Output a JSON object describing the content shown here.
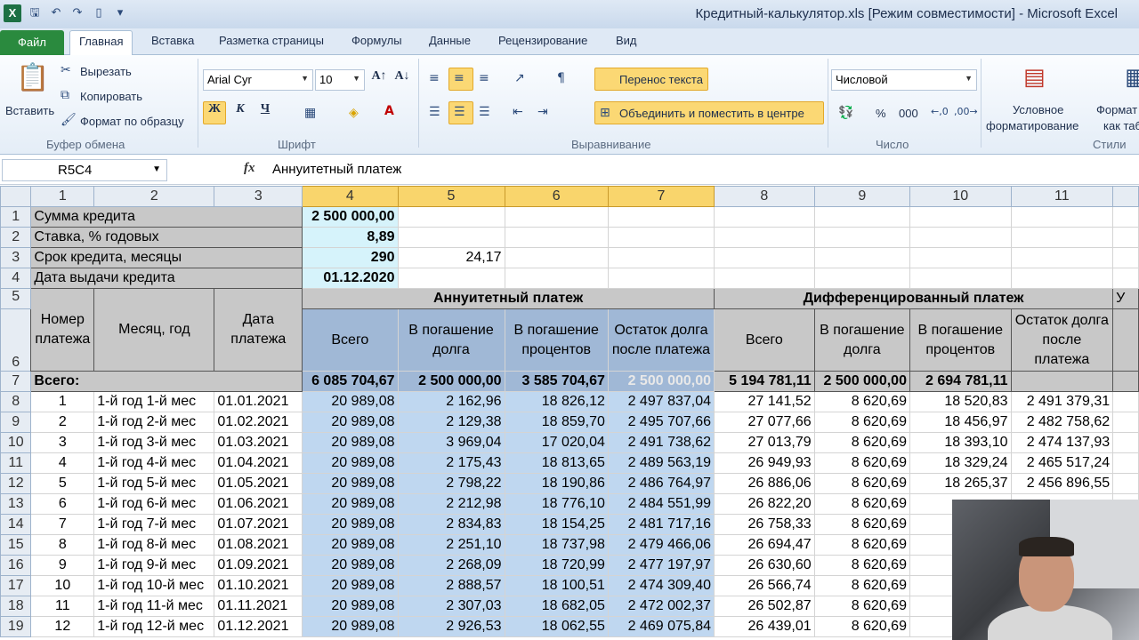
{
  "window": {
    "app_icon": "X",
    "title": "Кредитный-калькулятор.xls  [Режим совместимости] - Microsoft Excel"
  },
  "ribbon_tabs": [
    "Файл",
    "Главная",
    "Вставка",
    "Разметка страницы",
    "Формулы",
    "Данные",
    "Рецензирование",
    "Вид"
  ],
  "ribbon": {
    "paste": "Вставить",
    "cut": "Вырезать",
    "copy": "Копировать",
    "format_painter": "Формат по образцу",
    "clipboard_group": "Буфер обмена",
    "font_name": "Arial Cyr",
    "font_size": "10",
    "bold": "Ж",
    "italic": "К",
    "underline": "Ч",
    "font_group": "Шрифт",
    "wrap_text": "Перенос текста",
    "merge_center": "Объединить и поместить в центре",
    "alignment_group": "Выравнивание",
    "number_format": "Числовой",
    "percent": "%",
    "thousands": "000",
    "number_group": "Число",
    "cond_format_1": "Условное",
    "cond_format_2": "форматирование",
    "styles_1": "Формат",
    "styles_2": "как таб",
    "styles_group": "Стили"
  },
  "formula_bar": {
    "name_box": "R5C4",
    "fx": "fx",
    "value": "Аннуитетный платеж"
  },
  "columns": [
    "1",
    "2",
    "3",
    "4",
    "5",
    "6",
    "7",
    "8",
    "9",
    "10",
    "11"
  ],
  "params": [
    {
      "row": "1",
      "label": "Сумма кредита",
      "value": "2 500 000,00",
      "extra": ""
    },
    {
      "row": "2",
      "label": "Ставка, % годовых",
      "value": "8,89",
      "extra": ""
    },
    {
      "row": "3",
      "label": "Срок кредита, месяцы",
      "value": "290",
      "extra": "24,17"
    },
    {
      "row": "4",
      "label": "Дата выдачи кредита",
      "value": "01.12.2020",
      "extra": ""
    }
  ],
  "headers": {
    "row5": "5",
    "row6": "6",
    "num": "Номер платежа",
    "month": "Месяц, год",
    "date": "Дата платежа",
    "annuity": "Аннуитетный платеж",
    "diff": "Дифференцированный платеж",
    "total": "Всего",
    "principal_ann": "В погашение долга",
    "interest": "В погашение процентов",
    "balance": "Остаток долга после платежа",
    "principal_diff": "В погашение долга",
    "cut_off": "У"
  },
  "totals": {
    "row": "7",
    "label": "Всего:",
    "ann_total": "6 085 704,67",
    "ann_principal": "2 500 000,00",
    "ann_interest": "3 585 704,67",
    "ann_balance": "2 500 000,00",
    "diff_total": "5 194 781,11",
    "diff_principal": "2 500 000,00",
    "diff_interest": "2 694 781,11"
  },
  "rows": [
    {
      "r": "8",
      "n": "1",
      "m": "1-й год 1-й мес",
      "d": "01.01.2021",
      "a1": "20 989,08",
      "a2": "2 162,96",
      "a3": "18 826,12",
      "a4": "2 497 837,04",
      "d1": "27 141,52",
      "d2": "8 620,69",
      "d3": "18 520,83",
      "d4": "2 491 379,31"
    },
    {
      "r": "9",
      "n": "2",
      "m": "1-й год 2-й мес",
      "d": "01.02.2021",
      "a1": "20 989,08",
      "a2": "2 129,38",
      "a3": "18 859,70",
      "a4": "2 495 707,66",
      "d1": "27 077,66",
      "d2": "8 620,69",
      "d3": "18 456,97",
      "d4": "2 482 758,62"
    },
    {
      "r": "10",
      "n": "3",
      "m": "1-й год 3-й мес",
      "d": "01.03.2021",
      "a1": "20 989,08",
      "a2": "3 969,04",
      "a3": "17 020,04",
      "a4": "2 491 738,62",
      "d1": "27 013,79",
      "d2": "8 620,69",
      "d3": "18 393,10",
      "d4": "2 474 137,93"
    },
    {
      "r": "11",
      "n": "4",
      "m": "1-й год 4-й мес",
      "d": "01.04.2021",
      "a1": "20 989,08",
      "a2": "2 175,43",
      "a3": "18 813,65",
      "a4": "2 489 563,19",
      "d1": "26 949,93",
      "d2": "8 620,69",
      "d3": "18 329,24",
      "d4": "2 465 517,24"
    },
    {
      "r": "12",
      "n": "5",
      "m": "1-й год 5-й мес",
      "d": "01.05.2021",
      "a1": "20 989,08",
      "a2": "2 798,22",
      "a3": "18 190,86",
      "a4": "2 486 764,97",
      "d1": "26 886,06",
      "d2": "8 620,69",
      "d3": "18 265,37",
      "d4": "2 456 896,55"
    },
    {
      "r": "13",
      "n": "6",
      "m": "1-й год 6-й мес",
      "d": "01.06.2021",
      "a1": "20 989,08",
      "a2": "2 212,98",
      "a3": "18 776,10",
      "a4": "2 484 551,99",
      "d1": "26 822,20",
      "d2": "8 620,69",
      "d3": "",
      "d4": ""
    },
    {
      "r": "14",
      "n": "7",
      "m": "1-й год 7-й мес",
      "d": "01.07.2021",
      "a1": "20 989,08",
      "a2": "2 834,83",
      "a3": "18 154,25",
      "a4": "2 481 717,16",
      "d1": "26 758,33",
      "d2": "8 620,69",
      "d3": "",
      "d4": ""
    },
    {
      "r": "15",
      "n": "8",
      "m": "1-й год 8-й мес",
      "d": "01.08.2021",
      "a1": "20 989,08",
      "a2": "2 251,10",
      "a3": "18 737,98",
      "a4": "2 479 466,06",
      "d1": "26 694,47",
      "d2": "8 620,69",
      "d3": "",
      "d4": ""
    },
    {
      "r": "16",
      "n": "9",
      "m": "1-й год 9-й мес",
      "d": "01.09.2021",
      "a1": "20 989,08",
      "a2": "2 268,09",
      "a3": "18 720,99",
      "a4": "2 477 197,97",
      "d1": "26 630,60",
      "d2": "8 620,69",
      "d3": "",
      "d4": ""
    },
    {
      "r": "17",
      "n": "10",
      "m": "1-й год 10-й мес",
      "d": "01.10.2021",
      "a1": "20 989,08",
      "a2": "2 888,57",
      "a3": "18 100,51",
      "a4": "2 474 309,40",
      "d1": "26 566,74",
      "d2": "8 620,69",
      "d3": "",
      "d4": ""
    },
    {
      "r": "18",
      "n": "11",
      "m": "1-й год 11-й мес",
      "d": "01.11.2021",
      "a1": "20 989,08",
      "a2": "2 307,03",
      "a3": "18 682,05",
      "a4": "2 472 002,37",
      "d1": "26 502,87",
      "d2": "8 620,69",
      "d3": "",
      "d4": ""
    },
    {
      "r": "19",
      "n": "12",
      "m": "1-й год 12-й мес",
      "d": "01.12.2021",
      "a1": "20 989,08",
      "a2": "2 926,53",
      "a3": "18 062,55",
      "a4": "2 469 075,84",
      "d1": "26 439,01",
      "d2": "8 620,69",
      "d3": "",
      "d4": ""
    }
  ]
}
